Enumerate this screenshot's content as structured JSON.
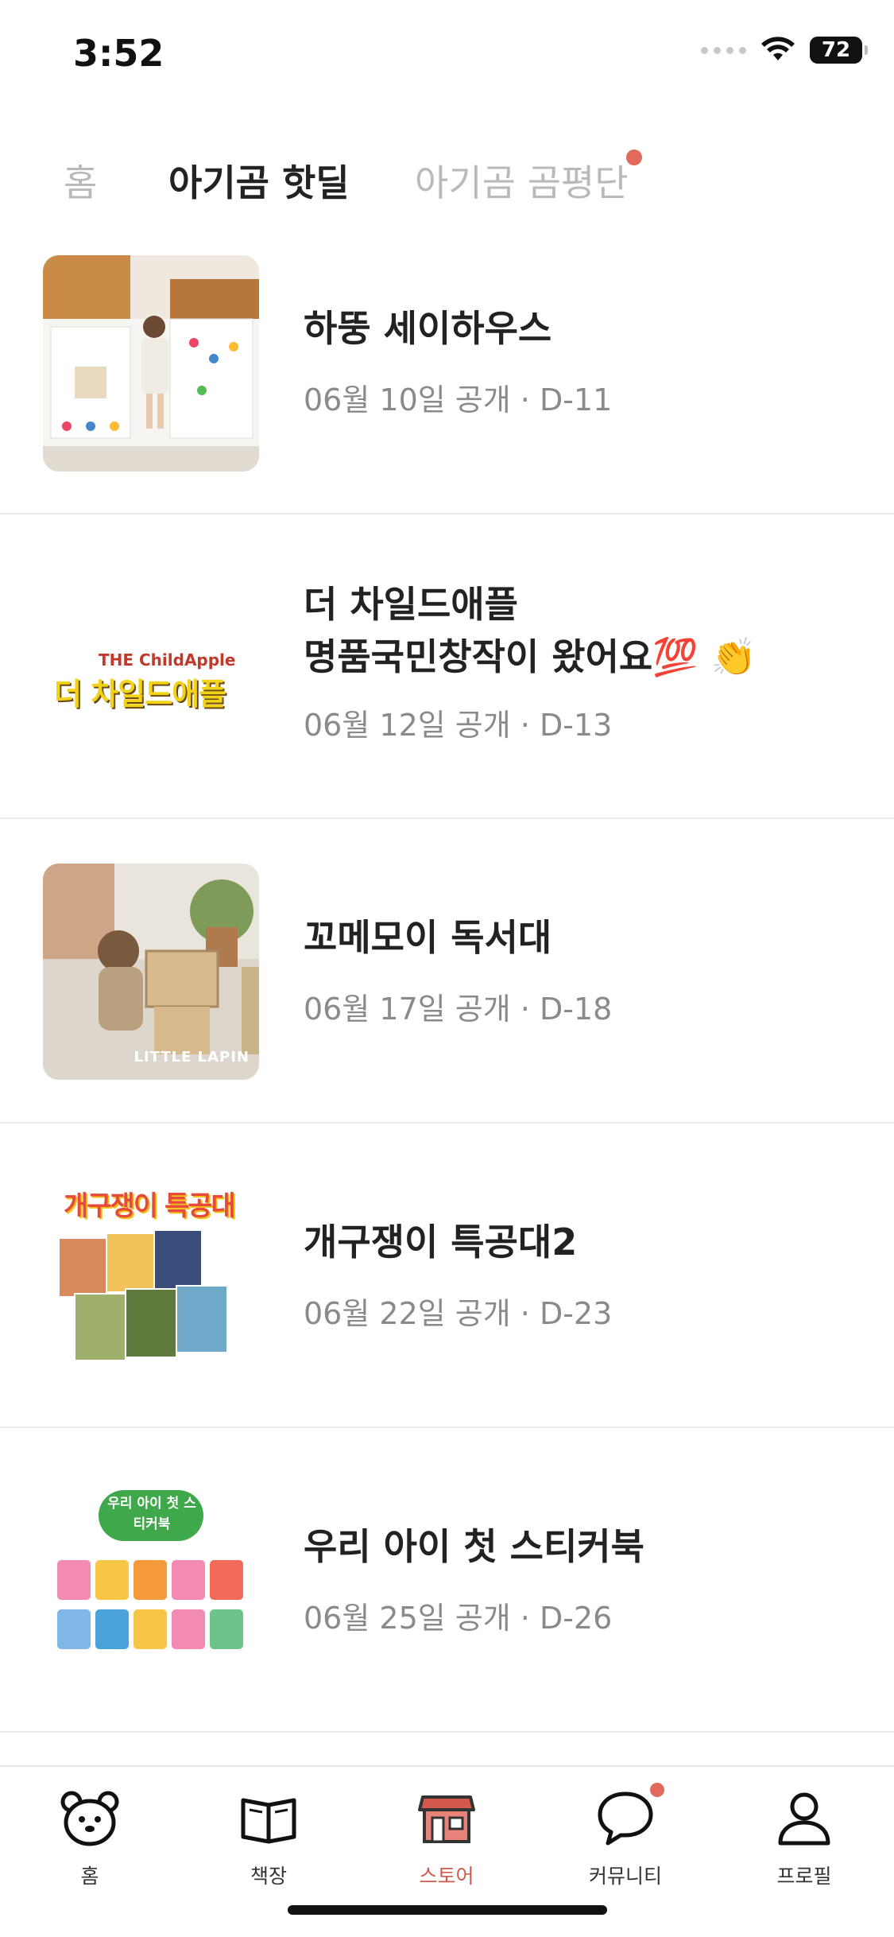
{
  "status_bar": {
    "time": "3:52",
    "battery": "72"
  },
  "tabs": [
    {
      "label": "홈",
      "active": false
    },
    {
      "label": "아기곰 핫딜",
      "active": true
    },
    {
      "label": "아기곰 곰평단",
      "active": false,
      "has_dot": true
    }
  ],
  "deals": [
    {
      "title": "하뚱 세이하우스",
      "meta": "06월 10일 공개 · D-11",
      "thumb": "playhouse-photo"
    },
    {
      "title": "더 차일드애플\n명품국민창작이 왔어요💯 👏",
      "meta": "06월 12일 공개 · D-13",
      "thumb": "childapple-logo",
      "logo_small": "THE ChildApple",
      "logo_big": "더 차일드애플"
    },
    {
      "title": "꼬메모이 독서대",
      "meta": "06월 17일 공개 · D-18",
      "thumb": "reading-stand-photo",
      "logo_small": "LITTLE LAPIN"
    },
    {
      "title": "개구쟁이 특공대2",
      "meta": "06월 22일 공개 · D-23",
      "thumb": "book-set-cover",
      "logo_big": "개구쟁이 특공대"
    },
    {
      "title": "우리 아이 첫 스티커북",
      "meta": "06월 25일 공개 · D-26",
      "thumb": "sticker-book-cover",
      "logo_big": "우리 아이 첫 스티커북"
    }
  ],
  "bottom_nav": [
    {
      "label": "홈",
      "icon": "bear-icon"
    },
    {
      "label": "책장",
      "icon": "book-icon"
    },
    {
      "label": "스토어",
      "icon": "store-icon",
      "active": true
    },
    {
      "label": "커뮤니티",
      "icon": "chat-icon",
      "has_dot": true
    },
    {
      "label": "프로필",
      "icon": "person-icon"
    }
  ],
  "colors": {
    "accent": "#d2594c",
    "notification_dot": "#e26a5c",
    "inactive_text": "#b9b9b9",
    "meta_text": "#8a8a8a"
  }
}
